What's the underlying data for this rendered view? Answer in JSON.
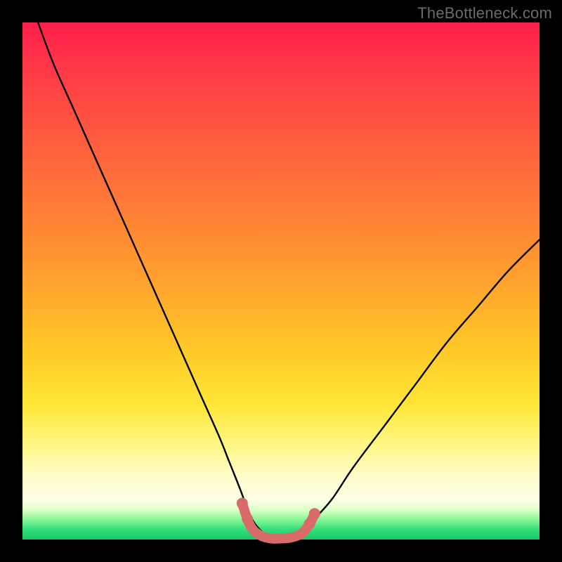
{
  "watermark": "TheBottleneck.com",
  "chart_data": {
    "type": "line",
    "title": "",
    "xlabel": "",
    "ylabel": "",
    "xlim": [
      0,
      100
    ],
    "ylim": [
      0,
      100
    ],
    "series": [
      {
        "name": "bottleneck-curve",
        "x": [
          3,
          6,
          10,
          14,
          18,
          22,
          26,
          30,
          34,
          38,
          40,
          42,
          43.5,
          45,
          47,
          49,
          51,
          53,
          55,
          57,
          60,
          64,
          70,
          76,
          82,
          88,
          94,
          100
        ],
        "values": [
          100,
          92,
          83,
          74,
          65,
          56,
          47,
          38,
          29,
          20,
          15,
          10,
          6,
          3,
          1,
          0,
          0,
          0.5,
          2,
          4.5,
          8,
          14,
          22,
          30,
          38,
          45,
          52,
          58
        ]
      },
      {
        "name": "highlight-marker",
        "x": [
          42.5,
          43.5,
          44.5,
          46,
          48,
          50,
          52,
          54,
          55.5,
          56.5
        ],
        "values": [
          7,
          4,
          2,
          0.8,
          0.2,
          0.2,
          0.4,
          1.2,
          3,
          5
        ]
      }
    ],
    "colors": {
      "curve": "#000000",
      "marker": "#d86a6a"
    }
  }
}
